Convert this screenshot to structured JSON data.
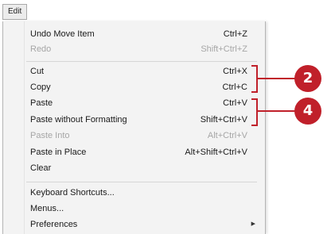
{
  "menubar": {
    "title": "Edit"
  },
  "menu": {
    "items": [
      {
        "label": "Undo Move Item",
        "shortcut": "Ctrl+Z"
      },
      {
        "label": "Redo",
        "shortcut": "Shift+Ctrl+Z"
      },
      {
        "label": "Cut",
        "shortcut": "Ctrl+X"
      },
      {
        "label": "Copy",
        "shortcut": "Ctrl+C"
      },
      {
        "label": "Paste",
        "shortcut": "Ctrl+V"
      },
      {
        "label": "Paste without Formatting",
        "shortcut": "Shift+Ctrl+V"
      },
      {
        "label": "Paste Into",
        "shortcut": "Alt+Ctrl+V"
      },
      {
        "label": "Paste in Place",
        "shortcut": "Alt+Shift+Ctrl+V"
      },
      {
        "label": "Clear",
        "shortcut": ""
      },
      {
        "label": "Keyboard Shortcuts...",
        "shortcut": ""
      },
      {
        "label": "Menus...",
        "shortcut": ""
      },
      {
        "label": "Preferences",
        "shortcut": ""
      }
    ],
    "disabled_items": [
      "Redo",
      "Paste Into"
    ],
    "submenu_arrow_icon": "chevron-right-icon"
  },
  "callouts": [
    {
      "number": "2",
      "target": "Cut and Copy"
    },
    {
      "number": "4",
      "target": "Paste and Paste without Formatting"
    }
  ],
  "colors": {
    "callout": "#c0202a",
    "menu_background": "#f3f3f3",
    "disabled_text": "#a6a6a6"
  }
}
